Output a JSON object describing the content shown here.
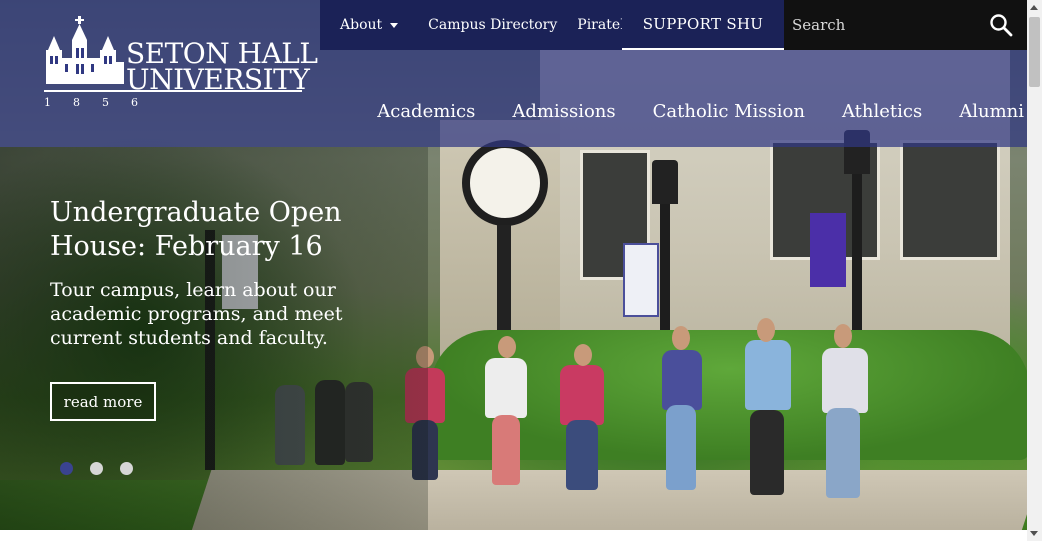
{
  "header": {
    "logo": {
      "line1": "SETON HALL",
      "line2": "UNIVERSITY",
      "year": "1856",
      "icon": "university-building-icon"
    },
    "utility_nav": [
      {
        "label": "About",
        "has_dropdown": true
      },
      {
        "label": "Campus Directory"
      },
      {
        "label": "PirateNet"
      }
    ],
    "support_label": "SUPPORT SHU",
    "search": {
      "placeholder": "Search",
      "value": "",
      "icon": "search-icon"
    },
    "main_nav": [
      "Academics",
      "Admissions",
      "Catholic Mission",
      "Athletics",
      "Alumni"
    ]
  },
  "hero": {
    "title": "Undergraduate Open House: February 16",
    "description": "Tour campus, learn about our academic programs, and meet current students and faculty.",
    "cta_label": "read more",
    "slide_count": 3,
    "active_slide": 1
  },
  "colors": {
    "brand_blue": "#303882",
    "utility_bar": "#1b2257",
    "search_bg": "#111111",
    "active_dot": "#3a4390"
  }
}
